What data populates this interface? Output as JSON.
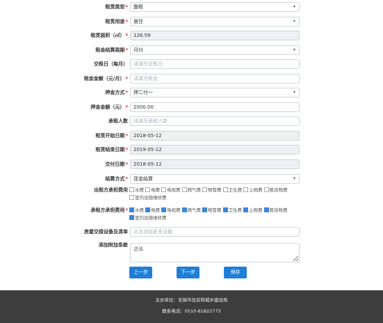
{
  "form": {
    "rent_type": {
      "label": "租赁类型",
      "value": "整租"
    },
    "rent_use": {
      "label": "租赁用途",
      "value": "居住"
    },
    "area": {
      "label": "租赁面积（㎡）",
      "value": "126.59"
    },
    "cycle": {
      "label": "租金结算周期",
      "value": "月付"
    },
    "pay_day": {
      "label": "交租日（每月）",
      "placeholder": "请填写交租日"
    },
    "rent_amount": {
      "label": "租金金额（元/月）",
      "placeholder": "请填写租金"
    },
    "deposit_method": {
      "label": "押金方式",
      "value": "押二付一"
    },
    "deposit_amount": {
      "label": "押金金额（元）",
      "value": "2000.00"
    },
    "tenant_count": {
      "label": "承租人数",
      "placeholder": "请填写承租人数"
    },
    "start_date": {
      "label": "租赁开始日期",
      "value": "2018-05-12"
    },
    "end_date": {
      "label": "租赁结束日期",
      "value": "2019-05-12"
    },
    "delivery_date": {
      "label": "交付日期",
      "value": "2018-05-12"
    },
    "settle_method": {
      "label": "结算方式",
      "value": "现金结算"
    },
    "lessor_fees": {
      "label": "出租方承担费用",
      "items": [
        {
          "name": "水费",
          "checked": false
        },
        {
          "name": "电费",
          "checked": false
        },
        {
          "name": "电视费",
          "checked": false
        },
        {
          "name": "燃气费",
          "checked": false
        },
        {
          "name": "物管费",
          "checked": false
        },
        {
          "name": "卫生费",
          "checked": false
        },
        {
          "name": "上网费",
          "checked": false
        },
        {
          "name": "租赁税费",
          "checked": false
        },
        {
          "name": "室内设施维修费",
          "checked": false
        }
      ]
    },
    "lessee_fees": {
      "label": "承租方承担费用",
      "items": [
        {
          "name": "水费",
          "checked": true
        },
        {
          "name": "电费",
          "checked": true
        },
        {
          "name": "电视费",
          "checked": true
        },
        {
          "name": "燃气费",
          "checked": true
        },
        {
          "name": "物管费",
          "checked": true
        },
        {
          "name": "卫生费",
          "checked": true
        },
        {
          "name": "上网费",
          "checked": true
        },
        {
          "name": "租赁税费",
          "checked": true
        },
        {
          "name": "室内设施维修费",
          "checked": true
        }
      ]
    },
    "equipment": {
      "label": "房屋交接设备及清单",
      "placeholder": "点击添加更多设备"
    },
    "extra_terms": {
      "label": "添加附加条款",
      "placeholder": "选填"
    }
  },
  "buttons": {
    "prev": "上一步",
    "next": "下一步",
    "save": "保存"
  },
  "footer": {
    "host": "主办单位：无锡市住房和城乡建设局",
    "phone": "联系电话：0510-81822773"
  },
  "colors": {
    "primary": "#1f7fd6",
    "required": "#e02020",
    "footer_bg": "#3d3d3d"
  }
}
